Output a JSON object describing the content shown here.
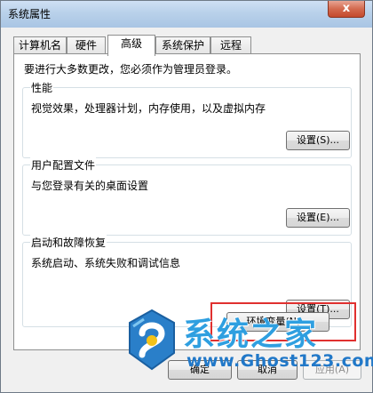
{
  "window": {
    "title": "系统属性",
    "close_glyph": "x"
  },
  "tabs": [
    {
      "label": "计算机名",
      "active": false
    },
    {
      "label": "硬件",
      "active": false
    },
    {
      "label": "高级",
      "active": true
    },
    {
      "label": "系统保护",
      "active": false
    },
    {
      "label": "远程",
      "active": false
    }
  ],
  "intro": "要进行大多数更改，您必须作为管理员登录。",
  "groups": {
    "performance": {
      "title": "性能",
      "description": "视觉效果，处理器计划，内存使用，以及虚拟内存",
      "button": "设置(S)..."
    },
    "user_profiles": {
      "title": "用户配置文件",
      "description": "与您登录有关的桌面设置",
      "button": "设置(E)..."
    },
    "startup_recovery": {
      "title": "启动和故障恢复",
      "description": "系统启动、系统失败和调试信息",
      "button": "设置(T)..."
    }
  },
  "env_button": "环境变量(N)...",
  "footer": {
    "ok": "确定",
    "cancel": "取消",
    "apply": "应用(A)"
  },
  "watermark": {
    "title": "系统之家",
    "url": "www.Ghost123.com"
  },
  "colors": {
    "highlight": "#e0302f",
    "watermark_text": "#2f9fe0",
    "watermark_url": "#2178c8"
  }
}
